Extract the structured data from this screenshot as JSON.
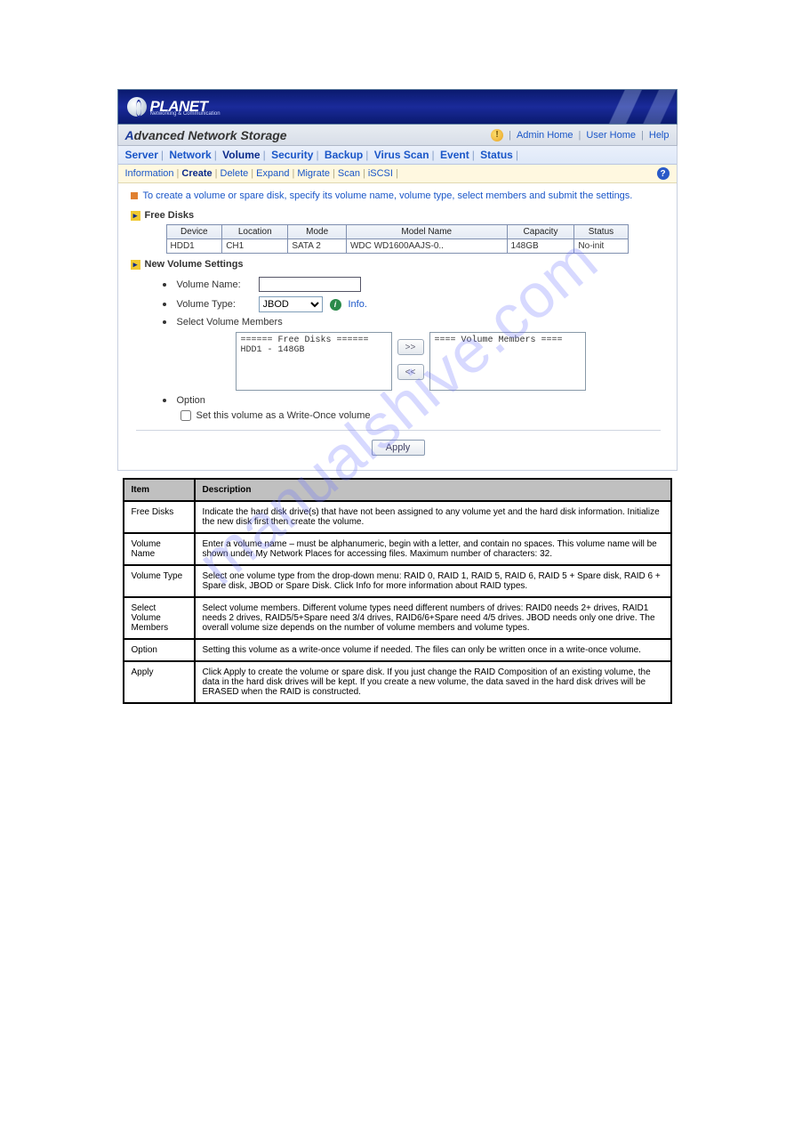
{
  "brand": {
    "name": "PLANET",
    "sub": "Networking & Communication"
  },
  "titlebar": {
    "title_prefix": "A",
    "title_rest": "dvanced Network Storage",
    "links": {
      "admin": "Admin Home",
      "user": "User Home",
      "help": "Help"
    }
  },
  "tabs_main": [
    "Server",
    "Network",
    "Volume",
    "Security",
    "Backup",
    "Virus Scan",
    "Event",
    "Status"
  ],
  "tabs_main_active": "Volume",
  "tabs_sub": [
    "Information",
    "Create",
    "Delete",
    "Expand",
    "Migrate",
    "Scan",
    "iSCSI"
  ],
  "tabs_sub_active": "Create",
  "instruction": "To create a volume or spare disk, specify its volume name, volume type, select members and submit the settings.",
  "section_free_disks": "Free Disks",
  "disk_columns": [
    "Device",
    "Location",
    "Mode",
    "Model Name",
    "Capacity",
    "Status"
  ],
  "disk_rows": [
    {
      "device": "HDD1",
      "location": "CH1",
      "mode": "SATA 2",
      "model": "WDC WD1600AAJS-0..",
      "capacity": "148GB",
      "status": "No-init"
    }
  ],
  "section_new_volume": "New Volume Settings",
  "form": {
    "volume_name_label": "Volume Name:",
    "volume_name_value": "",
    "volume_type_label": "Volume Type:",
    "volume_type_value": "JBOD",
    "volume_type_options": [
      "JBOD"
    ],
    "info_label": "Info.",
    "select_members_label": "Select Volume Members",
    "free_box_header": "====== Free Disks ======",
    "free_box_item": "HDD1 - 148GB",
    "members_box_header": "==== Volume Members ====",
    "option_label": "Option",
    "write_once_label": "Set this volume as a Write-Once volume",
    "write_once_checked": false,
    "apply_label": "Apply"
  },
  "desc_header": {
    "item": "Item",
    "desc": "Description"
  },
  "desc_rows": [
    {
      "item": "Free Disks",
      "desc": "Indicate the hard disk drive(s) that have not been assigned to any volume yet and the hard disk information. Initialize the new disk first then create the volume."
    },
    {
      "item": "Volume Name",
      "desc": "Enter a volume name – must be alphanumeric, begin with a letter, and contain no spaces. This volume name will be shown under My Network Places for accessing files. Maximum number of characters: 32."
    },
    {
      "item": "Volume Type",
      "desc": "Select one volume type from the drop-down menu: RAID 0, RAID 1, RAID 5, RAID 6, RAID 5 + Spare disk, RAID 6 + Spare disk, JBOD or Spare Disk. Click Info for more information about RAID types."
    },
    {
      "item": "Select Volume Members",
      "desc": "Select volume members. Different volume types need different numbers of drives: RAID0 needs 2+ drives, RAID1 needs 2 drives, RAID5/5+Spare need 3/4 drives, RAID6/6+Spare need 4/5 drives. JBOD needs only one drive. The overall volume size depends on the number of volume members and volume types."
    },
    {
      "item": "Option",
      "desc": "Setting this volume as a write-once volume if needed. The files can only be written once in a write-once volume."
    },
    {
      "item": "Apply",
      "desc": "Click Apply to create the volume or spare disk. If you just change the RAID Composition of an existing volume, the data in the hard disk drives will be kept. If you create a new volume, the data saved in the hard disk drives will be ERASED when the RAID is constructed."
    }
  ]
}
